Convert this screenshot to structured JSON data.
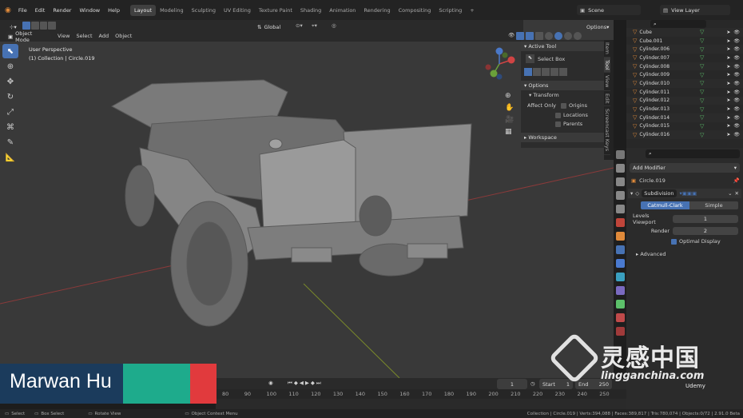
{
  "menu": [
    "File",
    "Edit",
    "Render",
    "Window",
    "Help"
  ],
  "workspaces": [
    "Layout",
    "Modeling",
    "Sculpting",
    "UV Editing",
    "Texture Paint",
    "Shading",
    "Animation",
    "Rendering",
    "Compositing",
    "Scripting"
  ],
  "active_workspace": "Layout",
  "scene": "Scene",
  "view_layer": "View Layer",
  "viewport": {
    "mode": "Object Mode",
    "menus": [
      "View",
      "Select",
      "Add",
      "Object"
    ],
    "orientation": "Global",
    "options": "Options",
    "overlay_line1": "User Perspective",
    "overlay_line2": "(1) Collection | Circle.019"
  },
  "npanel": {
    "active_tool": "Active Tool",
    "select_box": "Select Box",
    "options": "Options",
    "transform": "Transform",
    "affect_only": "Affect Only",
    "origins": "Origins",
    "locations": "Locations",
    "parents": "Parents",
    "workspace": "Workspace",
    "tabs": [
      "Item",
      "Tool",
      "View",
      "Edit",
      "Screencast Keys"
    ]
  },
  "outliner": [
    "Cube",
    "Cube.001",
    "Cylinder.006",
    "Cylinder.007",
    "Cylinder.008",
    "Cylinder.009",
    "Cylinder.010",
    "Cylinder.011",
    "Cylinder.012",
    "Cylinder.013",
    "Cylinder.014",
    "Cylinder.015",
    "Cylinder.016"
  ],
  "properties": {
    "add_modifier": "Add Modifier",
    "object": "Circle.019",
    "modifier": "Subdivision",
    "catmull": "Catmull-Clark",
    "simple": "Simple",
    "levels_viewport_label": "Levels Viewport",
    "levels_viewport": "1",
    "render_label": "Render",
    "render": "2",
    "optimal_display": "Optimal Display",
    "advanced": "Advanced"
  },
  "timeline": {
    "frame": "1",
    "start_label": "Start",
    "start": "1",
    "end_label": "End",
    "end": "250",
    "ticks": [
      "80",
      "90",
      "100",
      "110",
      "120",
      "130",
      "140",
      "150",
      "160",
      "170",
      "180",
      "190",
      "200",
      "210",
      "220",
      "230",
      "240",
      "250"
    ]
  },
  "status": {
    "select": "Select",
    "box_select": "Box Select",
    "rotate_view": "Rotate View",
    "context_menu": "Object Context Menu",
    "stats": "Collection | Circle.019 | Verts:394,088 | Faces:389,817 | Tris:780,074 | Objects:0/72 | 2.91.0 Beta"
  },
  "banner": {
    "name": "Marwan Hu"
  },
  "watermark": {
    "cn": "灵感中国",
    "url": "lingganchina.com",
    "udemy": "Udemy"
  },
  "colors": {
    "accent": "#4772b3",
    "banner_teal": "#1eab8c",
    "banner_red": "#e13a3d",
    "banner_navy": "#1b3b5c"
  }
}
